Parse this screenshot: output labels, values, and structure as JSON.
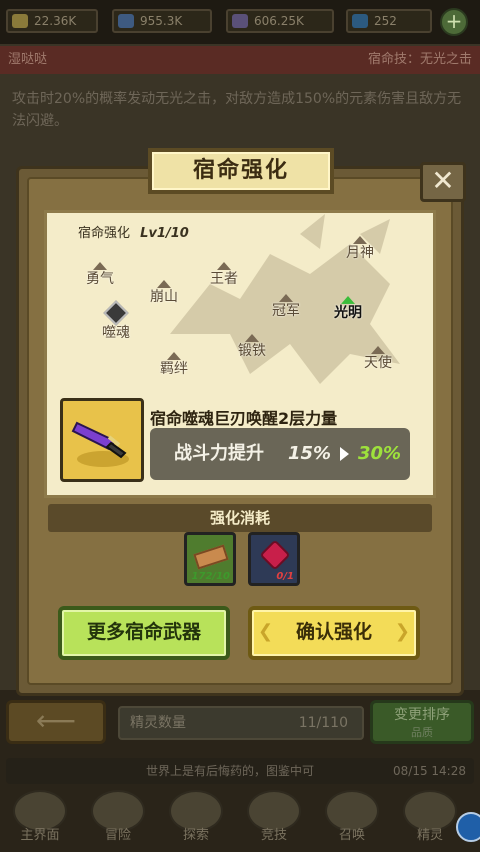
{
  "resources": [
    {
      "icon": "gold-icon",
      "value": "22.36K",
      "color": "#c9a13b"
    },
    {
      "icon": "exp-icon",
      "value": "955.3K",
      "color": "#5a8fd1"
    },
    {
      "icon": "soul-icon",
      "value": "606.25K",
      "color": "#8a7ab8"
    },
    {
      "icon": "diamond-icon",
      "value": "252",
      "color": "#3a8fd6"
    }
  ],
  "background": {
    "spirit_name": "湿哒哒",
    "fate_skill": "宿命技：无光之击",
    "description": "攻击时20%的概率发动无光之击，对敌方造成150%的元素伤害且敌方无法闪避。",
    "spirit_count_label": "精灵数量",
    "spirit_count": "11/110",
    "sort_button": "变更排序",
    "sort_sub": "品质",
    "info_message": "世界上是有后悔药的，图鉴中可",
    "info_time": "08/15  14:28",
    "nav": [
      "主界面",
      "冒险",
      "探索",
      "竞技",
      "召唤",
      "精灵"
    ]
  },
  "dialog": {
    "title": "宿命强化",
    "close": "✕",
    "level_label": "宿命强化",
    "level_value": "Lv1/10",
    "nodes": [
      {
        "label": "勇气",
        "active": false
      },
      {
        "label": "噬魂",
        "active": false
      },
      {
        "label": "崩山",
        "active": false
      },
      {
        "label": "王者",
        "active": false
      },
      {
        "label": "羁绊",
        "active": false
      },
      {
        "label": "锻铁",
        "active": false
      },
      {
        "label": "冠军",
        "active": false
      },
      {
        "label": "月神",
        "active": false
      },
      {
        "label": "光明",
        "active": true
      },
      {
        "label": "天使",
        "active": false
      }
    ],
    "weapon_name": "宿命噬魂巨刃唤醒2层力量",
    "power_label": "战斗力提升",
    "power_from": "15%",
    "power_to": "30%",
    "cost_title": "强化消耗",
    "costs": [
      {
        "icon": "wood-icon",
        "qty": "172/10",
        "color": "#3d9a2c"
      },
      {
        "icon": "ruby-icon",
        "qty": "0/1",
        "color": "#e04040"
      }
    ],
    "more_button": "更多宿命武器",
    "confirm_button": "确认强化"
  }
}
